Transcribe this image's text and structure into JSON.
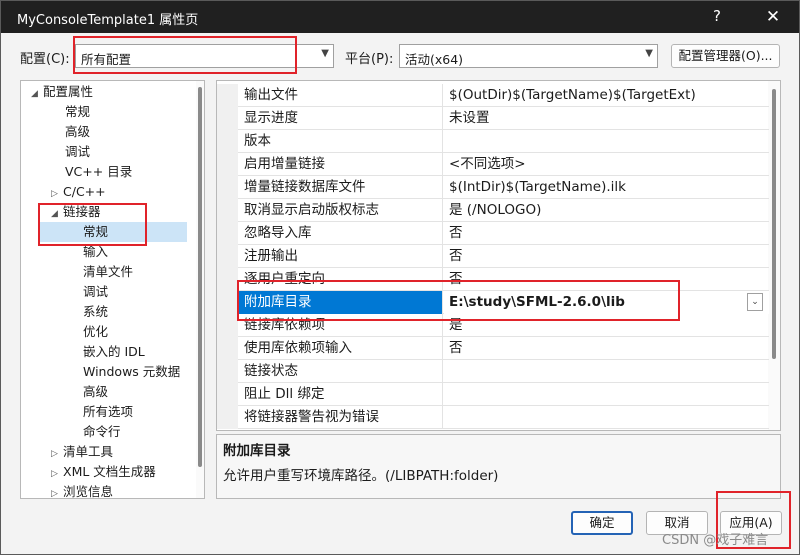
{
  "window": {
    "title": "MyConsoleTemplate1 属性页",
    "help_glyph": "?",
    "close_glyph": "✕"
  },
  "config_bar": {
    "config_label": "配置(C):",
    "config_value": "所有配置",
    "platform_label": "平台(P):",
    "platform_value": "活动(x64)",
    "manager_button": "配置管理器(O)..."
  },
  "tree": {
    "items": [
      {
        "label": "配置属性",
        "toggle": "◢"
      },
      {
        "label": "常规"
      },
      {
        "label": "高级"
      },
      {
        "label": "调试"
      },
      {
        "label": "VC++ 目录"
      },
      {
        "label": "C/C++",
        "toggle": "▷"
      },
      {
        "label": "链接器",
        "toggle": "◢"
      },
      {
        "label": "常规"
      },
      {
        "label": "输入"
      },
      {
        "label": "清单文件"
      },
      {
        "label": "调试"
      },
      {
        "label": "系统"
      },
      {
        "label": "优化"
      },
      {
        "label": "嵌入的 IDL"
      },
      {
        "label": "Windows 元数据"
      },
      {
        "label": "高级"
      },
      {
        "label": "所有选项"
      },
      {
        "label": "命令行"
      },
      {
        "label": "清单工具",
        "toggle": "▷"
      },
      {
        "label": "XML 文档生成器",
        "toggle": "▷"
      },
      {
        "label": "浏览信息",
        "toggle": "▷"
      }
    ]
  },
  "grid": {
    "rows": [
      {
        "name": "输出文件",
        "value": "$(OutDir)$(TargetName)$(TargetExt)"
      },
      {
        "name": "显示进度",
        "value": "未设置"
      },
      {
        "name": "版本",
        "value": ""
      },
      {
        "name": "启用增量链接",
        "value": "<不同选项>"
      },
      {
        "name": "增量链接数据库文件",
        "value": "$(IntDir)$(TargetName).ilk"
      },
      {
        "name": "取消显示启动版权标志",
        "value": "是 (/NOLOGO)"
      },
      {
        "name": "忽略导入库",
        "value": "否"
      },
      {
        "name": "注册输出",
        "value": "否"
      },
      {
        "name": "逐用户重定向",
        "value": "否"
      },
      {
        "name": "附加库目录",
        "value": "E:\\study\\SFML-2.6.0\\lib",
        "dropdown": "⌄"
      },
      {
        "name": "链接库依赖项",
        "value": "是"
      },
      {
        "name": "使用库依赖项输入",
        "value": "否"
      },
      {
        "name": "链接状态",
        "value": ""
      },
      {
        "name": "阻止 Dll 绑定",
        "value": ""
      },
      {
        "name": "将链接器警告视为错误",
        "value": ""
      }
    ]
  },
  "description": {
    "title": "附加库目录",
    "text": "允许用户重写环境库路径。(/LIBPATH:folder)"
  },
  "buttons": {
    "ok": "确定",
    "cancel": "取消",
    "apply": "应用(A)"
  },
  "watermark": "CSDN @戏子难言",
  "colors": {
    "selection": "#0078d4",
    "highlight_box": "#e0232a",
    "titlebar": "#202020"
  }
}
